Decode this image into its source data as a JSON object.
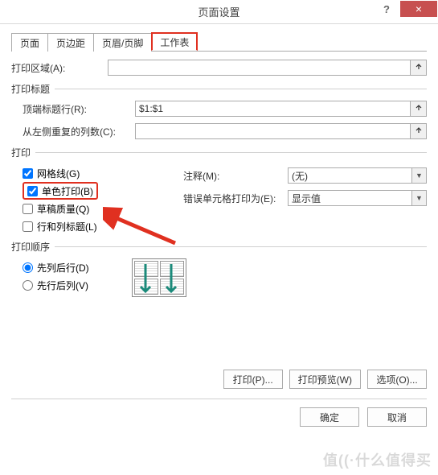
{
  "window": {
    "title": "页面设置",
    "helpTooltip": "?",
    "closeTooltip": "×"
  },
  "tabs": [
    {
      "label": "页面"
    },
    {
      "label": "页边距"
    },
    {
      "label": "页眉/页脚"
    },
    {
      "label": "工作表",
      "active": true
    }
  ],
  "printArea": {
    "label": "打印区域(A):",
    "value": ""
  },
  "printTitles": {
    "groupLabel": "打印标题",
    "topRow": {
      "label": "顶端标题行(R):",
      "value": "$1:$1"
    },
    "leftCol": {
      "label": "从左侧重复的列数(C):",
      "value": ""
    }
  },
  "printSection": {
    "groupLabel": "打印",
    "gridlines": {
      "label": "网格线(G)",
      "checked": true
    },
    "blackWhite": {
      "label": "单色打印(B)",
      "checked": true
    },
    "draft": {
      "label": "草稿质量(Q)",
      "checked": false
    },
    "rowColHeadings": {
      "label": "行和列标题(L)",
      "checked": false
    },
    "comments": {
      "label": "注释(M):",
      "value": "(无)"
    },
    "cellErrors": {
      "label": "错误单元格打印为(E):",
      "value": "显示值"
    }
  },
  "pageOrder": {
    "groupLabel": "打印顺序",
    "downOver": {
      "label": "先列后行(D)",
      "checked": true
    },
    "overDown": {
      "label": "先行后列(V)",
      "checked": false
    }
  },
  "buttons": {
    "print": "打印(P)...",
    "preview": "打印预览(W)",
    "options": "选项(O)...",
    "ok": "确定",
    "cancel": "取消"
  },
  "watermark": "值((·什么值得买"
}
